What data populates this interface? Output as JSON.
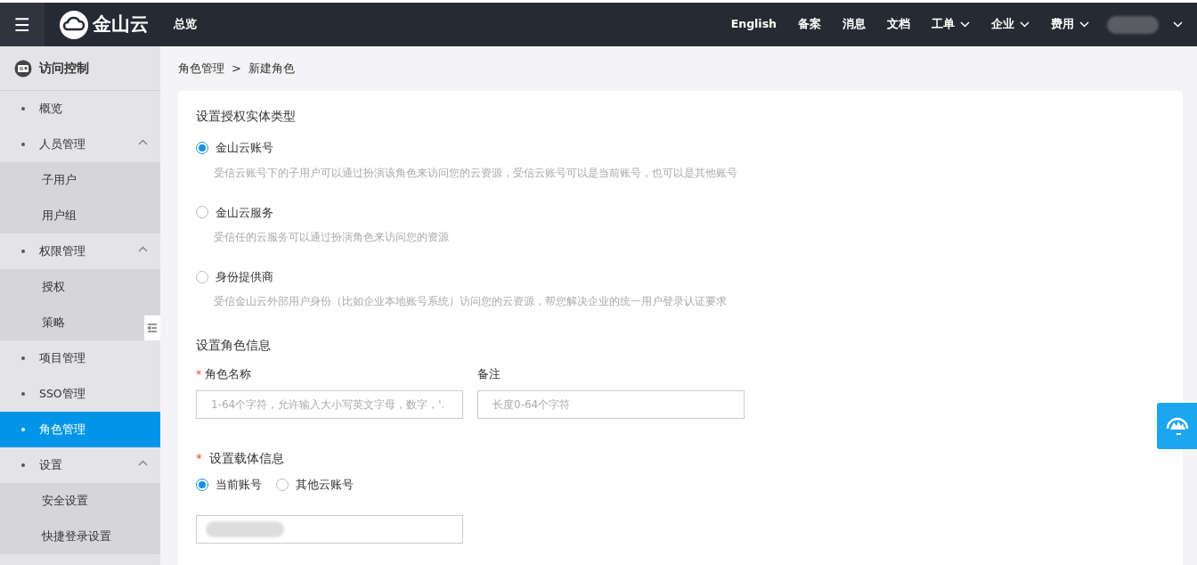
{
  "topbar": {
    "menu_label": "☰",
    "logo_text": "金山云",
    "home_link": "总览",
    "links": [
      {
        "label": "English",
        "has_menu": false
      },
      {
        "label": "备案",
        "has_menu": false
      },
      {
        "label": "消息",
        "has_menu": false
      },
      {
        "label": "文档",
        "has_menu": false
      },
      {
        "label": "工单",
        "has_menu": true
      },
      {
        "label": "企业",
        "has_menu": true
      },
      {
        "label": "费用",
        "has_menu": true
      }
    ]
  },
  "sidebar": {
    "title": "访问控制",
    "items": [
      {
        "label": "概览",
        "selected": false
      },
      {
        "label": "人员管理",
        "selected": false,
        "expanded": true,
        "children": [
          {
            "label": "子用户",
            "selected": false
          },
          {
            "label": "用户组",
            "selected": false
          }
        ]
      },
      {
        "label": "权限管理",
        "selected": false,
        "expanded": true,
        "children": [
          {
            "label": "授权",
            "selected": false
          },
          {
            "label": "策略",
            "selected": false
          }
        ]
      },
      {
        "label": "项目管理",
        "selected": false
      },
      {
        "label": "SSO管理",
        "selected": false
      },
      {
        "label": "角色管理",
        "selected": true
      },
      {
        "label": "设置",
        "selected": false,
        "expanded": true,
        "children": [
          {
            "label": "安全设置",
            "selected": false
          },
          {
            "label": "快捷登录设置",
            "selected": false
          }
        ]
      }
    ]
  },
  "breadcrumb": {
    "parent": "角色管理",
    "separator": ">",
    "current": "新建角色"
  },
  "form": {
    "entity_title": "设置授权实体类型",
    "entity_types": [
      {
        "label": "金山云账号",
        "description": "受信云账号下的子用户可以通过扮演该角色来访问您的云资源，受信云账号可以是当前账号，也可以是其他账号",
        "selected": true
      },
      {
        "label": "金山云服务",
        "description": "受信任的云服务可以通过扮演角色来访问您的资源",
        "selected": false
      },
      {
        "label": "身份提供商",
        "description": "受信金山云外部用户身份（比如企业本地账号系统）访问您的云资源，帮您解决企业的统一用户登录认证要求",
        "selected": false
      }
    ],
    "role_title": "设置角色信息",
    "fields": [
      {
        "label": "角色名称",
        "required_mark": "*",
        "placeholder": "1-64个字符，允许输入大小写英文字母，数字，'."
      },
      {
        "label": "备注",
        "placeholder": "长度0-64个字符"
      }
    ],
    "carrier": {
      "label": "设置载体信息",
      "required_mark": "*",
      "options": [
        {
          "label": "当前账号",
          "selected": true
        },
        {
          "label": "其他云账号",
          "selected": false
        }
      ]
    }
  }
}
